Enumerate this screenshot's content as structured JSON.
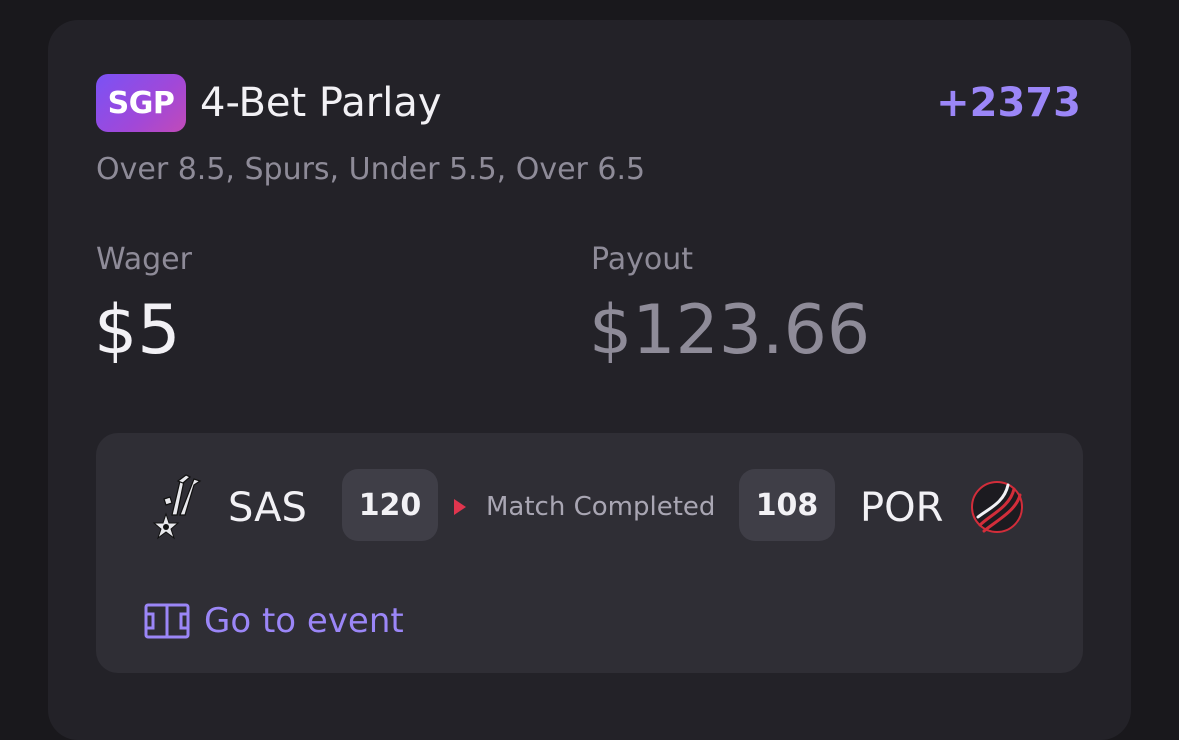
{
  "bet": {
    "badge": "SGP",
    "title": "4-Bet Parlay",
    "odds": "+2373",
    "legs": "Over 8.5, Spurs, Under 5.5, Over 6.5"
  },
  "wager": {
    "label": "Wager",
    "value": "$5"
  },
  "payout": {
    "label": "Payout",
    "value": "$123.66"
  },
  "event": {
    "home": {
      "abbr": "SAS",
      "score": "120",
      "logo_icon": "spurs-logo-icon"
    },
    "away": {
      "abbr": "POR",
      "score": "108",
      "logo_icon": "blazers-logo-icon"
    },
    "status": "Match Completed",
    "status_icon": "play-icon",
    "goto_label": "Go to event",
    "goto_icon": "court-icon"
  },
  "colors": {
    "accent": "#9b86f7",
    "live_dot": "#e0354e",
    "badge_gradient_start": "#7a52f5",
    "badge_gradient_end": "#c14ab8"
  }
}
